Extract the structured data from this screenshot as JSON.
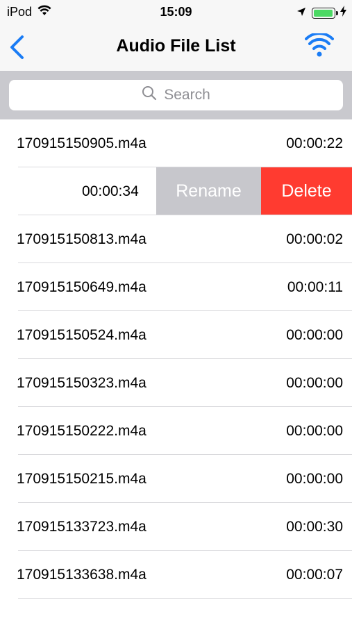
{
  "status_bar": {
    "carrier": "iPod",
    "time": "15:09",
    "battery_level": 1.0
  },
  "nav": {
    "title": "Audio File List",
    "back_icon": "chevron-left-icon",
    "right_icon": "wifi-icon",
    "accent_color": "#1a7cf5"
  },
  "search": {
    "placeholder": "Search"
  },
  "files": [
    {
      "name": "170915150905.m4a",
      "duration": "00:00:22"
    },
    {
      "name": "",
      "duration": "00:00:34",
      "swiped": true
    },
    {
      "name": "170915150813.m4a",
      "duration": "00:00:02"
    },
    {
      "name": "170915150649.m4a",
      "duration": "00:00:11"
    },
    {
      "name": "170915150524.m4a",
      "duration": "00:00:00"
    },
    {
      "name": "170915150323.m4a",
      "duration": "00:00:00"
    },
    {
      "name": "170915150222.m4a",
      "duration": "00:00:00"
    },
    {
      "name": "170915150215.m4a",
      "duration": "00:00:00"
    },
    {
      "name": "170915133723.m4a",
      "duration": "00:00:30"
    },
    {
      "name": "170915133638.m4a",
      "duration": "00:00:07"
    }
  ],
  "row_actions": {
    "rename_label": "Rename",
    "delete_label": "Delete",
    "rename_color": "#c7c7cc",
    "delete_color": "#ff3b30"
  }
}
